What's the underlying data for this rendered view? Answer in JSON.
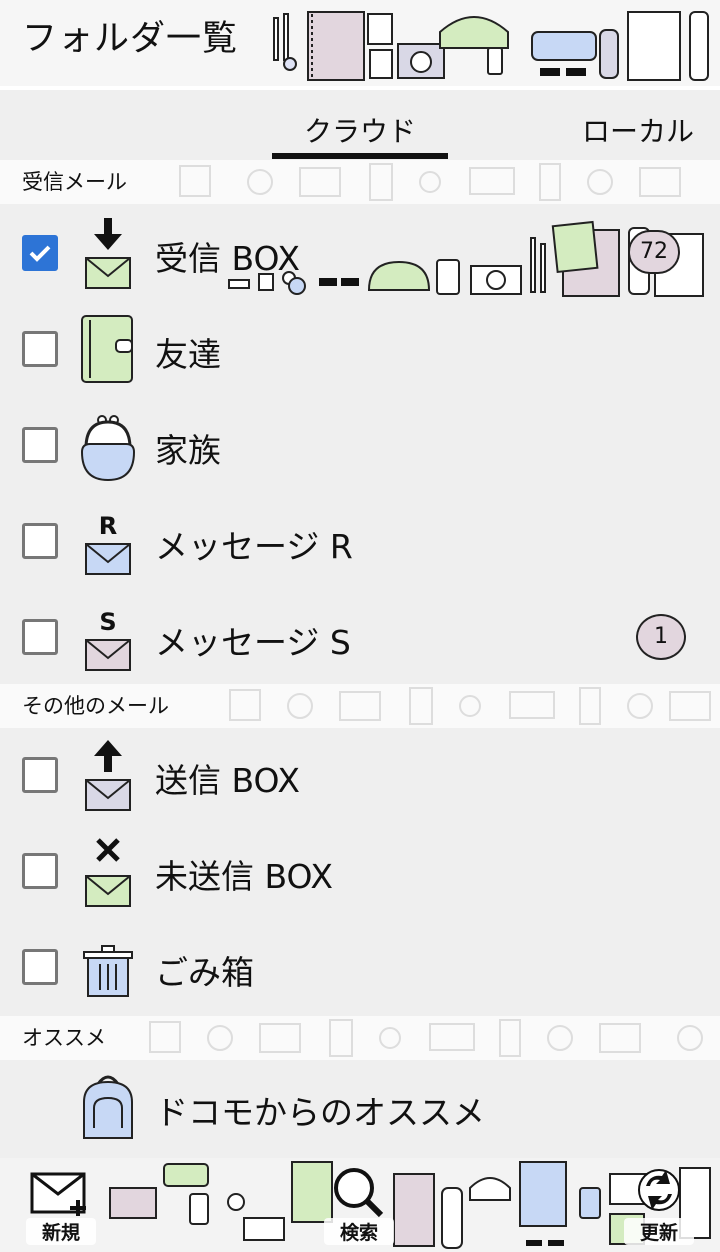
{
  "header": {
    "title": "フォルダ一覧"
  },
  "tabs": [
    {
      "label": "クラウド",
      "active": true
    },
    {
      "label": "ローカル",
      "active": false
    }
  ],
  "sections": {
    "inbox": "受信メール",
    "other": "その他のメール",
    "recommend": "オススメ"
  },
  "folders": [
    {
      "label": "受信 BOX",
      "checked": true,
      "badge": "72",
      "icon": "inbox-download-icon"
    },
    {
      "label": "友達",
      "checked": false,
      "badge": "",
      "icon": "green-notebook-icon"
    },
    {
      "label": "家族",
      "checked": false,
      "badge": "",
      "icon": "coin-purse-icon"
    },
    {
      "label": "メッセージ R",
      "checked": false,
      "badge": "",
      "icon": "envelope-r-icon"
    },
    {
      "label": "メッセージ S",
      "checked": false,
      "badge": "1",
      "icon": "envelope-s-icon"
    }
  ],
  "other_folders": [
    {
      "label": "送信 BOX",
      "checked": false,
      "icon": "outbox-upload-icon"
    },
    {
      "label": "未送信 BOX",
      "checked": false,
      "icon": "unsent-envelope-icon"
    },
    {
      "label": "ごみ箱",
      "checked": false,
      "icon": "trash-icon"
    }
  ],
  "recommend": {
    "label": "ドコモからのオススメ",
    "icon": "backpack-icon"
  },
  "toolbar": {
    "new_label": "新規",
    "search_label": "検索",
    "refresh_label": "更新"
  },
  "colors": {
    "accent": "#2d74d6",
    "green": "#d4ecc0",
    "blue": "#c7d8f5",
    "pink": "#e2d6de",
    "lavender": "#d9d8e6"
  }
}
